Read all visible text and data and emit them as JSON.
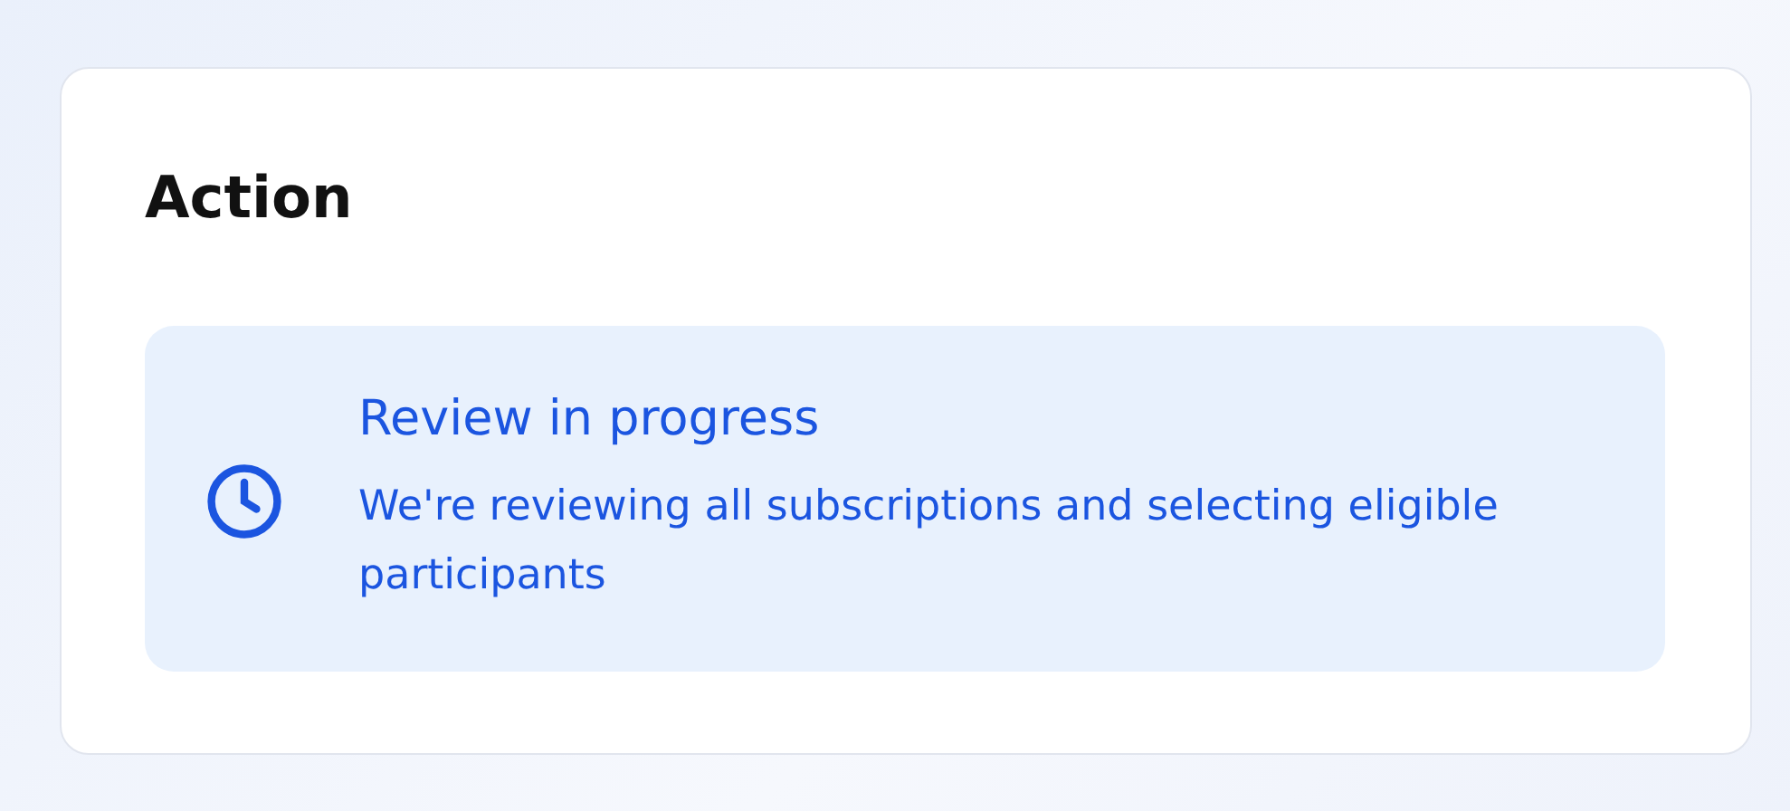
{
  "card": {
    "title": "Action",
    "notice": {
      "kind": "info",
      "title": "Review in progress",
      "message": "We're reviewing all subscriptions and selecting eligible participants"
    }
  }
}
